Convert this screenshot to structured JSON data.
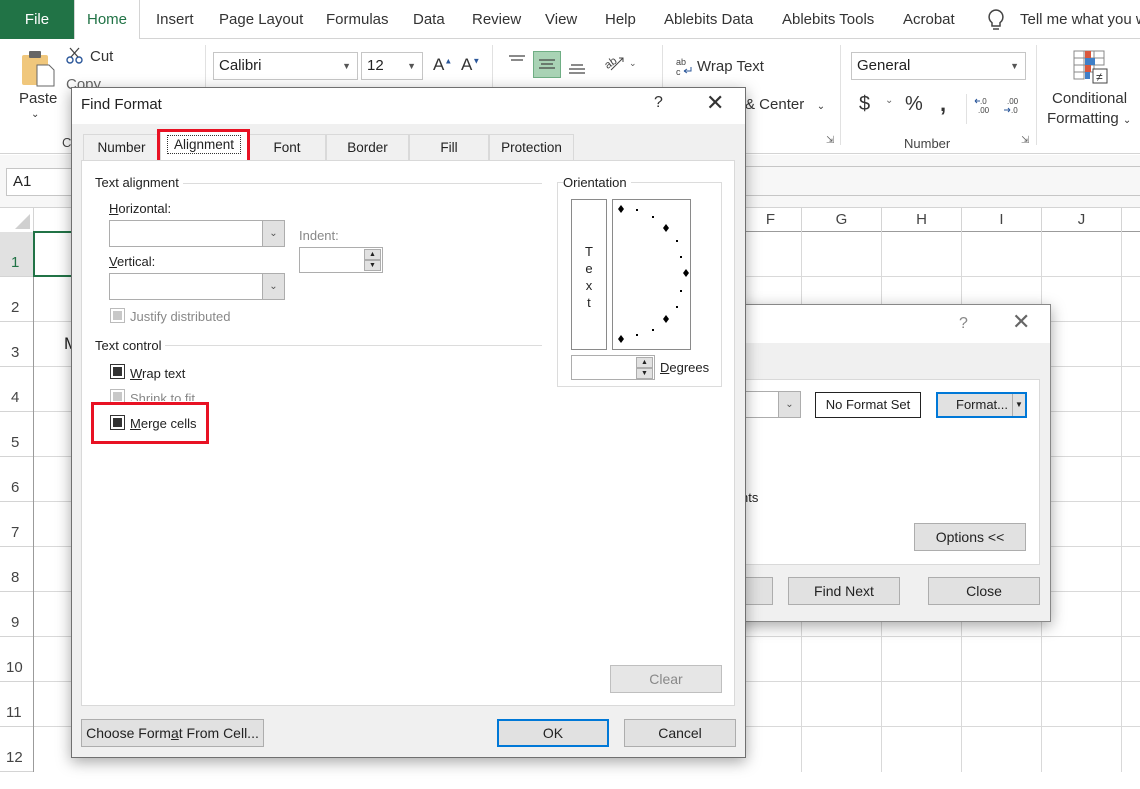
{
  "ribbon": {
    "tabs": [
      "File",
      "Home",
      "Insert",
      "Page Layout",
      "Formulas",
      "Data",
      "Review",
      "View",
      "Help",
      "Ablebits Data",
      "Ablebits Tools",
      "Acrobat"
    ],
    "active_tab": "Home",
    "tell_me": "Tell me what you want to do",
    "clipboard": {
      "paste": "Paste",
      "cut": "Cut",
      "copy": "Copy",
      "group": "Clipboard"
    },
    "font": {
      "name": "Calibri",
      "size": "12"
    },
    "alignment": {
      "wrap_text": "Wrap Text",
      "merge_center": "Merge & Center"
    },
    "number": {
      "format": "General",
      "group": "Number",
      "currency": "$",
      "percent": "%",
      "comma": ",",
      "inc_decimal": "←.0 .00",
      "dec_decimal": ".00 →.0"
    },
    "styles": {
      "conditional_formatting": "Conditional Formatting"
    }
  },
  "formula_bar": {
    "name_box": "A1"
  },
  "grid": {
    "columns": [
      "F",
      "G",
      "H",
      "I",
      "J"
    ],
    "rows": [
      "1",
      "2",
      "3",
      "4",
      "5",
      "6",
      "7",
      "8",
      "9",
      "10",
      "11",
      "12"
    ],
    "partial_cell_text": "M"
  },
  "find_replace": {
    "format_preview": "No Format Set",
    "format_button": "Format...",
    "partial_label": "nts",
    "options_button": "Options <<",
    "find_next": "Find Next",
    "close": "Close"
  },
  "find_format": {
    "title": "Find Format",
    "help": "?",
    "tabs": [
      "Number",
      "Alignment",
      "Font",
      "Border",
      "Fill",
      "Protection"
    ],
    "active_tab": "Alignment",
    "text_alignment": {
      "legend": "Text alignment",
      "horizontal_label": "Horizontal:",
      "horizontal_value": "",
      "vertical_label": "Vertical:",
      "vertical_value": "",
      "indent_label": "Indent:",
      "indent_value": "",
      "justify_distributed": "Justify distributed"
    },
    "text_control": {
      "legend": "Text control",
      "wrap_text": "Wrap text",
      "shrink_to_fit": "Shrink to fit",
      "merge_cells": "Merge cells"
    },
    "orientation": {
      "legend": "Orientation",
      "vertical_text": [
        "T",
        "e",
        "x",
        "t"
      ],
      "degrees_value": "",
      "degrees_label": "Degrees"
    },
    "clear": "Clear",
    "choose_from_cell": "Choose Format From Cell...",
    "ok": "OK",
    "cancel": "Cancel"
  },
  "highlight_color": "#e81123",
  "accent_color": "#217346"
}
